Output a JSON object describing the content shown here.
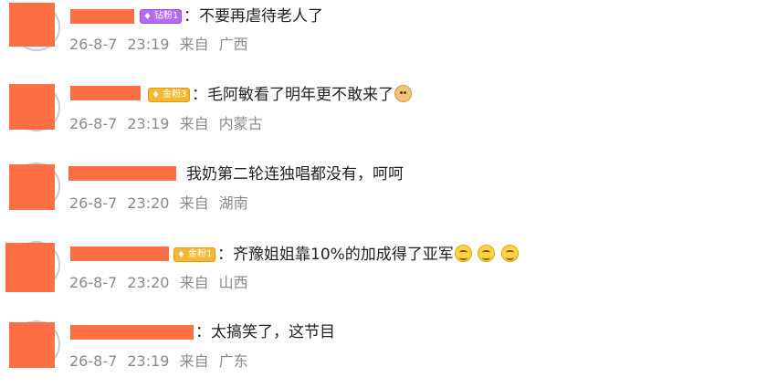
{
  "comments": [
    {
      "badge": "钻粉1",
      "badge_type": "diamond",
      "badge_icon": "diamond-icon",
      "text": "：不要再虐待老人了",
      "date": "26-8-7",
      "time": "23:19",
      "from": "来自",
      "location": "广西"
    },
    {
      "badge": "金粉3",
      "badge_type": "gold",
      "badge_icon": "gold-diamond-icon",
      "text": "：毛阿敏看了明年更不敢来了",
      "emojis": [
        "doge-emoji"
      ],
      "date": "26-8-7",
      "time": "23:19",
      "from": "来自",
      "location": "内蒙古"
    },
    {
      "text": "我奶第二轮连独唱都没有，呵呵",
      "date": "26-8-7",
      "time": "23:20",
      "from": "来自",
      "location": "湖南"
    },
    {
      "badge": "金粉1",
      "badge_type": "gold",
      "badge_icon": "gold-diamond-icon",
      "text": "：齐豫姐姐靠10%的加成得了亚军",
      "emojis": [
        "smile-emoji",
        "smile-emoji",
        "smile-emoji"
      ],
      "date": "26-8-7",
      "time": "23:20",
      "from": "来自",
      "location": "山西"
    },
    {
      "text": "：太搞笑了，这节目",
      "date": "26-8-7",
      "time": "23:19",
      "from": "来自",
      "location": "广东"
    }
  ],
  "colors": {
    "redaction": "#fc6f45",
    "meta_text": "#8a8a8a",
    "body_text": "#222222",
    "diamond_badge": "#b46cf2",
    "gold_badge": "#f7b733"
  }
}
